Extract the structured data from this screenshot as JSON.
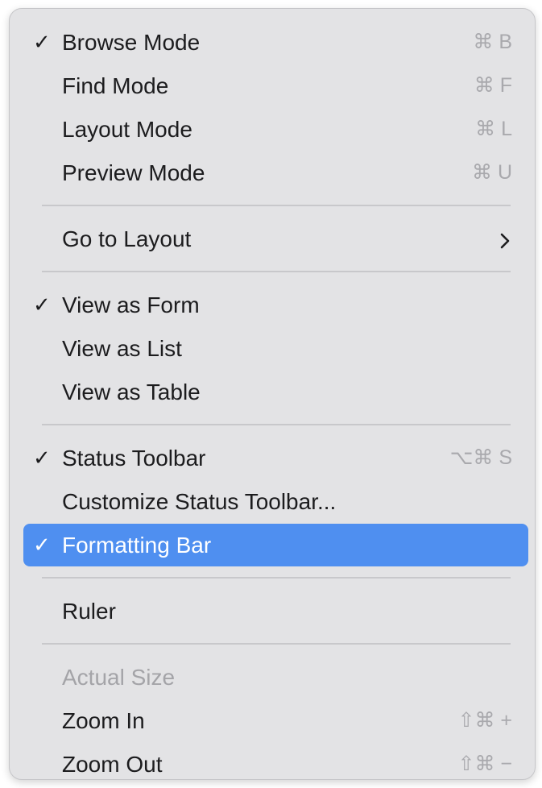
{
  "menu": {
    "items": [
      {
        "check": "✓",
        "label": "Browse Mode",
        "shortcut": "⌘ B"
      },
      {
        "check": "",
        "label": "Find Mode",
        "shortcut": "⌘ F"
      },
      {
        "check": "",
        "label": "Layout Mode",
        "shortcut": "⌘ L"
      },
      {
        "check": "",
        "label": "Preview Mode",
        "shortcut": "⌘ U"
      },
      {
        "check": "",
        "label": "Go to Layout",
        "submenu": "›",
        "submenu_icon": "chevron-right-icon"
      },
      {
        "check": "✓",
        "label": "View as Form"
      },
      {
        "check": "",
        "label": "View as List"
      },
      {
        "check": "",
        "label": "View as Table"
      },
      {
        "check": "✓",
        "label": "Status Toolbar",
        "shortcut": "⌥⌘ S"
      },
      {
        "check": "",
        "label": "Customize Status Toolbar..."
      },
      {
        "check": "✓",
        "label": "Formatting Bar",
        "state": "highlighted"
      },
      {
        "check": "",
        "label": "Ruler"
      },
      {
        "check": "",
        "label": "Actual Size",
        "state": "disabled"
      },
      {
        "check": "",
        "label": "Zoom In",
        "shortcut": "⇧⌘ +"
      },
      {
        "check": "",
        "label": "Zoom Out",
        "shortcut": "⇧⌘ −"
      }
    ]
  },
  "colors": {
    "menu_background": "#e3e3e5",
    "highlight": "#4f8ff0",
    "text": "#1c1c1e",
    "disabled_text": "#a4a4a8",
    "shortcut_text": "#a9a9ad",
    "separator": "#c8c8cb"
  }
}
